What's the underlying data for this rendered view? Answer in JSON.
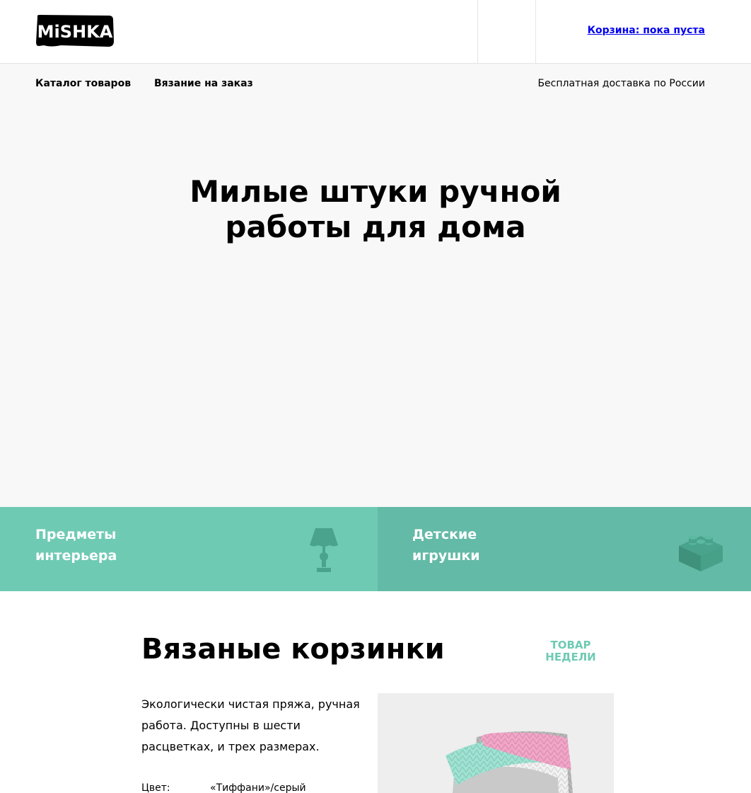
{
  "header": {
    "logo_text": "MiSHKA",
    "cart_label": "Корзина: пока пуста"
  },
  "nav": {
    "catalog": "Каталог товаров",
    "order": "Вязание на заказ",
    "delivery": "Бесплатная доставка по России"
  },
  "hero": {
    "title_line1": "Милые штуки ручной",
    "title_line2": "работы для дома"
  },
  "categories": [
    {
      "line1": "Предметы",
      "line2": "интерьера",
      "icon": "lamp-icon",
      "color": "#6fcab4"
    },
    {
      "line1": "Детские",
      "line2": "игрушки",
      "icon": "lego-icon",
      "color": "#63baa6"
    }
  ],
  "product": {
    "title": "Вязаные корзинки",
    "badge_line1": "ТОВАР",
    "badge_line2": "НЕДЕЛИ",
    "description": "Экологически чистая пряжа, ручная работа. Доступны в шести расцветках, и трех размерах.",
    "spec_label": "Цвет:",
    "spec_value": "«Тиффани»/серый"
  },
  "colors": {
    "accent": "#6fcab4",
    "accent_dark": "#63baa6",
    "background": "#f8f8f8"
  }
}
